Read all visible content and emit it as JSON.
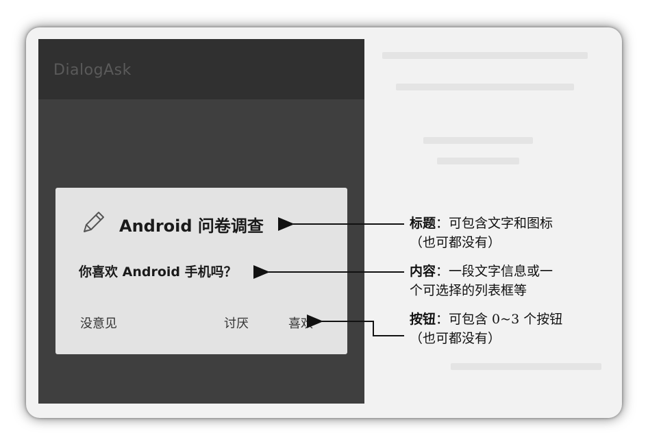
{
  "app": {
    "title": "DialogAsk"
  },
  "dialog": {
    "icon": "pencil-icon",
    "title": "Android 问卷调查",
    "message": "你喜欢 Android 手机吗？",
    "buttons": {
      "neutral": "没意见",
      "negative": "讨厌",
      "positive": "喜欢"
    }
  },
  "annotations": {
    "title": {
      "label": "标题",
      "line1": "：可包含文字和图标",
      "line2": "（也可都没有）"
    },
    "message": {
      "label": "内容",
      "line1": "：一段文字信息或一",
      "line2": "个可选择的列表框等"
    },
    "buttons": {
      "label": "按钮",
      "line1": "：可包含 0~3 个按钮",
      "line2": "（也可都没有）"
    }
  },
  "colors": {
    "phone_background": "#3f3f3f",
    "action_bar": "#303030",
    "dialog_background": "#e3e3e3"
  }
}
